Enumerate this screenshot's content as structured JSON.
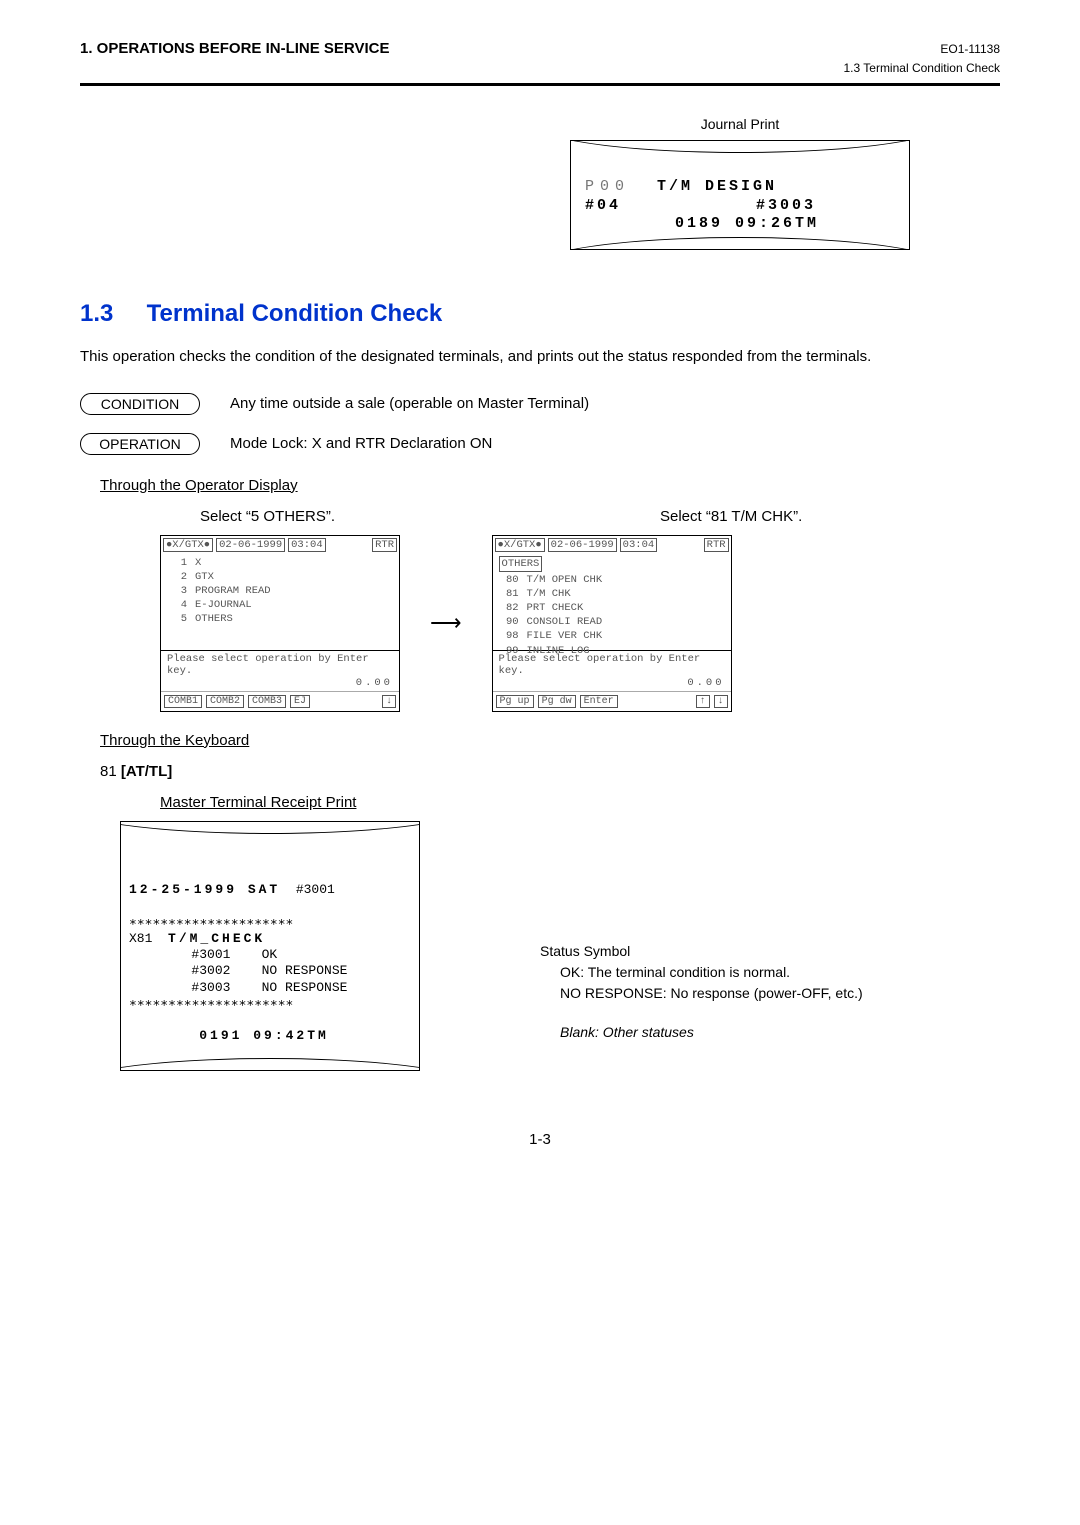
{
  "header": {
    "chapter": "1.   OPERATIONS BEFORE IN-LINE SERVICE",
    "doc_id": "EO1-11138",
    "breadcrumb": "1.3  Terminal Condition Check"
  },
  "journal": {
    "caption": "Journal Print",
    "line1_left": "P00",
    "line1_right": "T/M DESIGN",
    "line2_left": "#04",
    "line2_right": "#3003",
    "line3": "0189 09:26TM"
  },
  "section": {
    "number": "1.3",
    "title": "Terminal Condition Check",
    "intro": "This operation checks the condition of the designated terminals, and prints out the status responded from the terminals."
  },
  "pills": {
    "condition_label": "CONDITION",
    "condition_text": "Any time outside a sale (operable on Master Terminal)",
    "operation_label": "OPERATION",
    "operation_text": "Mode Lock:  X and RTR Declaration ON"
  },
  "operator_display_heading": "Through the Operator Display",
  "captions": {
    "left": "Select “5 OTHERS”.",
    "right": "Select “81 T/M CHK”."
  },
  "screen_common": {
    "mode": "●X/GTX●",
    "date": "02-06-1999",
    "time": "03:04",
    "rtr": "RTR",
    "prompt": "Please select operation by Enter key.",
    "amount": "0.00"
  },
  "screen1": {
    "menu": [
      {
        "n": "1",
        "t": "X"
      },
      {
        "n": "2",
        "t": "GTX"
      },
      {
        "n": "3",
        "t": "PROGRAM READ"
      },
      {
        "n": "4",
        "t": "E-JOURNAL"
      },
      {
        "n": "5",
        "t": "OTHERS"
      }
    ],
    "btns": [
      "COMB1",
      "COMB2",
      "COMB3",
      "EJ",
      "",
      "↓"
    ]
  },
  "screen2": {
    "title": "OTHERS",
    "menu": [
      {
        "n": "80",
        "t": "T/M OPEN CHK"
      },
      {
        "n": "81",
        "t": "T/M CHK"
      },
      {
        "n": "82",
        "t": "PRT CHECK"
      },
      {
        "n": "90",
        "t": "CONSOLI READ"
      },
      {
        "n": "98",
        "t": "FILE VER CHK"
      },
      {
        "n": "99",
        "t": "INLINE LOG"
      }
    ],
    "btns": [
      "Pg up",
      "Pg dw",
      "Enter",
      "",
      "↑",
      "↓"
    ]
  },
  "keyboard_heading": "Through the Keyboard",
  "keyboard_cmd_prefix": "81 ",
  "keyboard_cmd": "[AT/TL]",
  "master_label": "Master Terminal Receipt Print",
  "master_receipt": {
    "date": "12-25-1999 SAT",
    "term": "#3001",
    "stars": "∗∗∗∗∗∗∗∗∗∗∗∗∗∗∗∗∗∗∗∗∗",
    "x_line_code": "X81",
    "x_line_title": "T/M_CHECK",
    "rows": [
      {
        "id": "#3001",
        "st": "OK"
      },
      {
        "id": "#3002",
        "st": "NO RESPONSE"
      },
      {
        "id": "#3003",
        "st": "NO RESPONSE"
      }
    ],
    "footer": "0191 09:42TM"
  },
  "status": {
    "title": "Status Symbol",
    "ok": "OK:  The terminal condition is normal.",
    "nr": "NO RESPONSE:  No response (power-OFF, etc.)",
    "blank": "Blank:  Other statuses"
  },
  "page_number": "1-3"
}
